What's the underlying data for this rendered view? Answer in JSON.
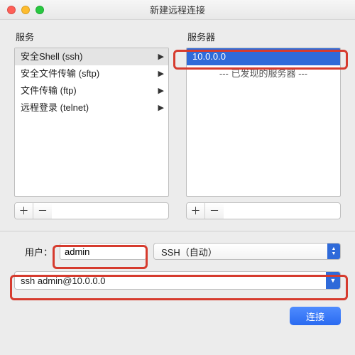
{
  "window": {
    "title": "新建远程连接"
  },
  "colors": {
    "accent": "#2f6ad9",
    "highlight": "#d63b2e"
  },
  "labels": {
    "services": "服务",
    "servers": "服务器",
    "user": "用户：",
    "add": "＋",
    "remove": "－"
  },
  "services": {
    "items": [
      {
        "label": "安全Shell (ssh)",
        "selected": true
      },
      {
        "label": "安全文件传输 (sftp)",
        "selected": false
      },
      {
        "label": "文件传输 (ftp)",
        "selected": false
      },
      {
        "label": "远程登录 (telnet)",
        "selected": false
      }
    ]
  },
  "servers": {
    "items": [
      {
        "label": "10.0.0.0",
        "selected": true,
        "discovered": false
      },
      {
        "label": "--- 已发现的服务器 ---",
        "selected": false,
        "discovered": true
      }
    ]
  },
  "user": {
    "value": "admin"
  },
  "protocol": {
    "selected": "SSH（自动）"
  },
  "command": {
    "value": "ssh admin@10.0.0.0"
  },
  "buttons": {
    "connect": "连接"
  }
}
